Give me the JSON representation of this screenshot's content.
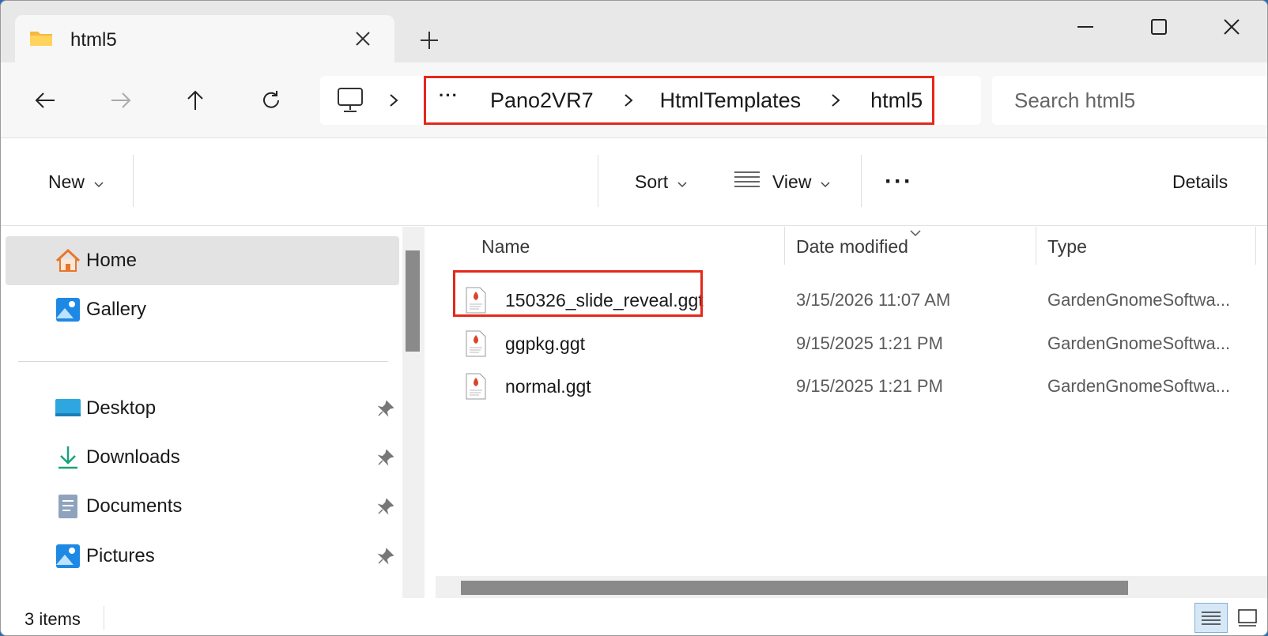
{
  "tab": {
    "title": "html5"
  },
  "address": {
    "overflow": "···",
    "crumbs": [
      "Pano2VR7",
      "HtmlTemplates",
      "html5"
    ]
  },
  "search": {
    "placeholder": "Search html5"
  },
  "commands": {
    "new": "New",
    "sort": "Sort",
    "view": "View",
    "more": "···",
    "details": "Details"
  },
  "sidebar": {
    "items": [
      {
        "label": "Home",
        "icon": "home-icon",
        "pinned": false
      },
      {
        "label": "Gallery",
        "icon": "gallery-icon",
        "pinned": false
      },
      {
        "label": "Desktop",
        "icon": "desktop-icon",
        "pinned": true
      },
      {
        "label": "Downloads",
        "icon": "downloads-icon",
        "pinned": true
      },
      {
        "label": "Documents",
        "icon": "documents-icon",
        "pinned": true
      },
      {
        "label": "Pictures",
        "icon": "pictures-icon",
        "pinned": true
      }
    ]
  },
  "columns": {
    "name": "Name",
    "date": "Date modified",
    "type": "Type"
  },
  "files": [
    {
      "name": "150326_slide_reveal.ggt",
      "date": "3/15/2026 11:07 AM",
      "type": "GardenGnomeSoftwa..."
    },
    {
      "name": "ggpkg.ggt",
      "date": "9/15/2025 1:21 PM",
      "type": "GardenGnomeSoftwa..."
    },
    {
      "name": "normal.ggt",
      "date": "9/15/2025 1:21 PM",
      "type": "GardenGnomeSoftwa..."
    }
  ],
  "status": {
    "count": "3 items"
  },
  "colors": {
    "highlight": "#e5271b",
    "accent": "#0067c0"
  }
}
